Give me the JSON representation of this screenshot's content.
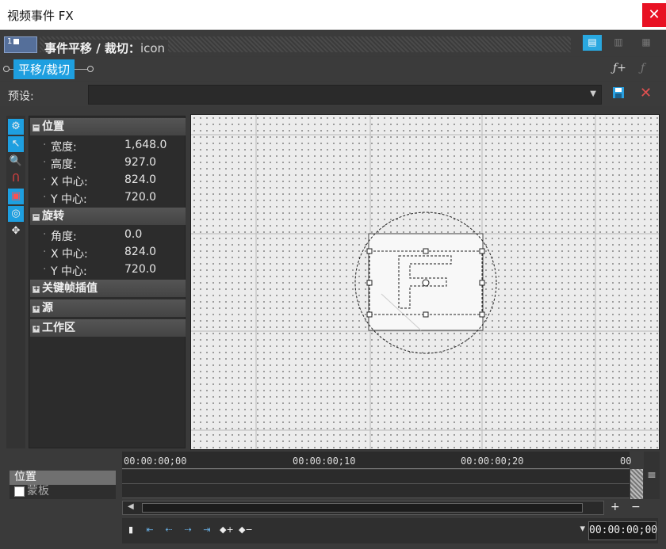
{
  "window": {
    "title": "视频事件 FX",
    "close_glyph": "✕"
  },
  "header": {
    "chip_label": "1",
    "title": "事件平移 / 裁切：",
    "title_suffix": "icon",
    "view_buttons": [
      "▤",
      "▥",
      "▦"
    ]
  },
  "fx": {
    "name": "平移/裁切",
    "fx_add_glyph": "ƒ+",
    "fx_disabled_glyph": "ƒ"
  },
  "preset": {
    "label": "预设:",
    "value": "",
    "arrow": "▼",
    "save_glyph": "💾",
    "delete_glyph": "✕"
  },
  "tools": [
    "⚙",
    "↖",
    "🔍",
    "Ո",
    "▣",
    "◎",
    "✥"
  ],
  "properties": {
    "groups": [
      {
        "title": "位置",
        "expanded": true,
        "rows": [
          {
            "name": "宽度:",
            "value": "1,648.0"
          },
          {
            "name": "高度:",
            "value": "927.0"
          },
          {
            "name": "X 中心:",
            "value": "824.0"
          },
          {
            "name": "Y 中心:",
            "value": "720.0"
          }
        ]
      },
      {
        "title": "旋转",
        "expanded": true,
        "rows": [
          {
            "name": "角度:",
            "value": "0.0"
          },
          {
            "name": "X 中心:",
            "value": "824.0"
          },
          {
            "name": "Y 中心:",
            "value": "720.0"
          }
        ]
      },
      {
        "title": "关键帧插值",
        "expanded": false
      },
      {
        "title": "源",
        "expanded": false
      },
      {
        "title": "工作区",
        "expanded": false
      }
    ],
    "expand_glyph": "⊞",
    "collapse_glyph": "⊟"
  },
  "timeline": {
    "ticks": [
      "00:00:00;00",
      "00:00:00;10",
      "00:00:00;20",
      "00"
    ],
    "tracks": [
      {
        "label": "位置",
        "selected": true
      },
      {
        "label": "蒙板",
        "selected": false
      }
    ],
    "menu_glyph": "≡",
    "zoom_in": "+",
    "zoom_out": "−",
    "current_time": "00:00:00;00",
    "keyframe_buttons": [
      "⇤",
      "⇠",
      "⇢",
      "⇥",
      "◆+",
      "◆−"
    ]
  }
}
